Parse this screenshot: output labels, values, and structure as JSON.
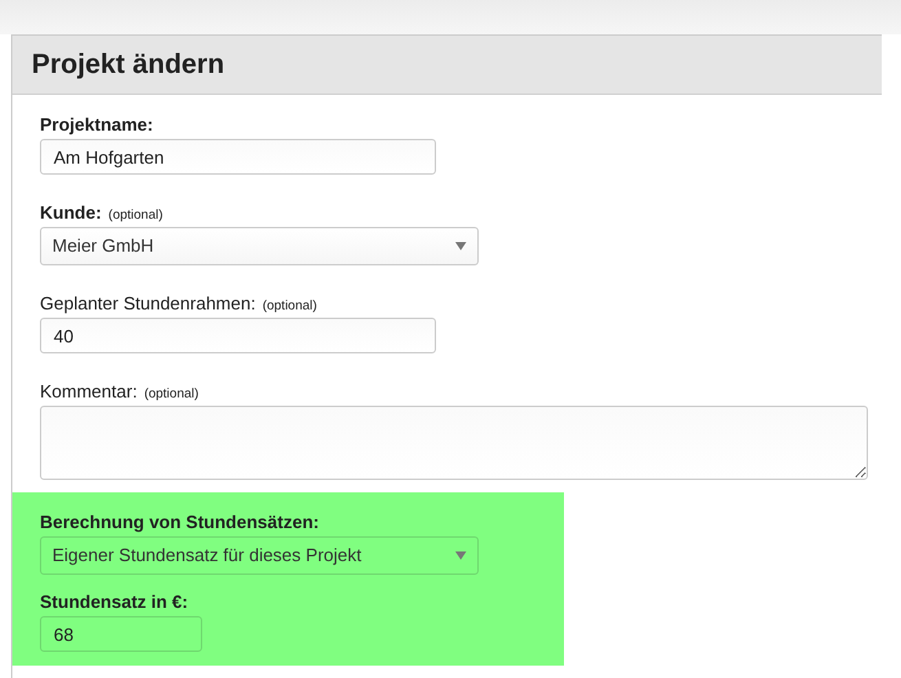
{
  "title": "Projekt ändern",
  "fields": [
    {
      "kind": "text",
      "label": "Projektname:",
      "bold": true,
      "value": "Am Hofgarten"
    },
    {
      "kind": "select",
      "label": "Kunde:",
      "bold": true,
      "note": "(optional)",
      "value": "Meier GmbH"
    },
    {
      "kind": "text",
      "label": "Geplanter Stundenrahmen:",
      "bold": false,
      "note": "(optional)",
      "value": "40"
    },
    {
      "kind": "textarea",
      "label": "Kommentar:",
      "bold": false,
      "note": "(optional)"
    }
  ],
  "highlight": {
    "fields": [
      {
        "kind": "select",
        "label": "Berechnung von Stundensätzen:",
        "bold": true,
        "value": "Eigener Stundensatz für dieses Projekt"
      },
      {
        "kind": "short",
        "label": "Stundensatz in €:",
        "bold": true,
        "value": "68"
      }
    ]
  }
}
